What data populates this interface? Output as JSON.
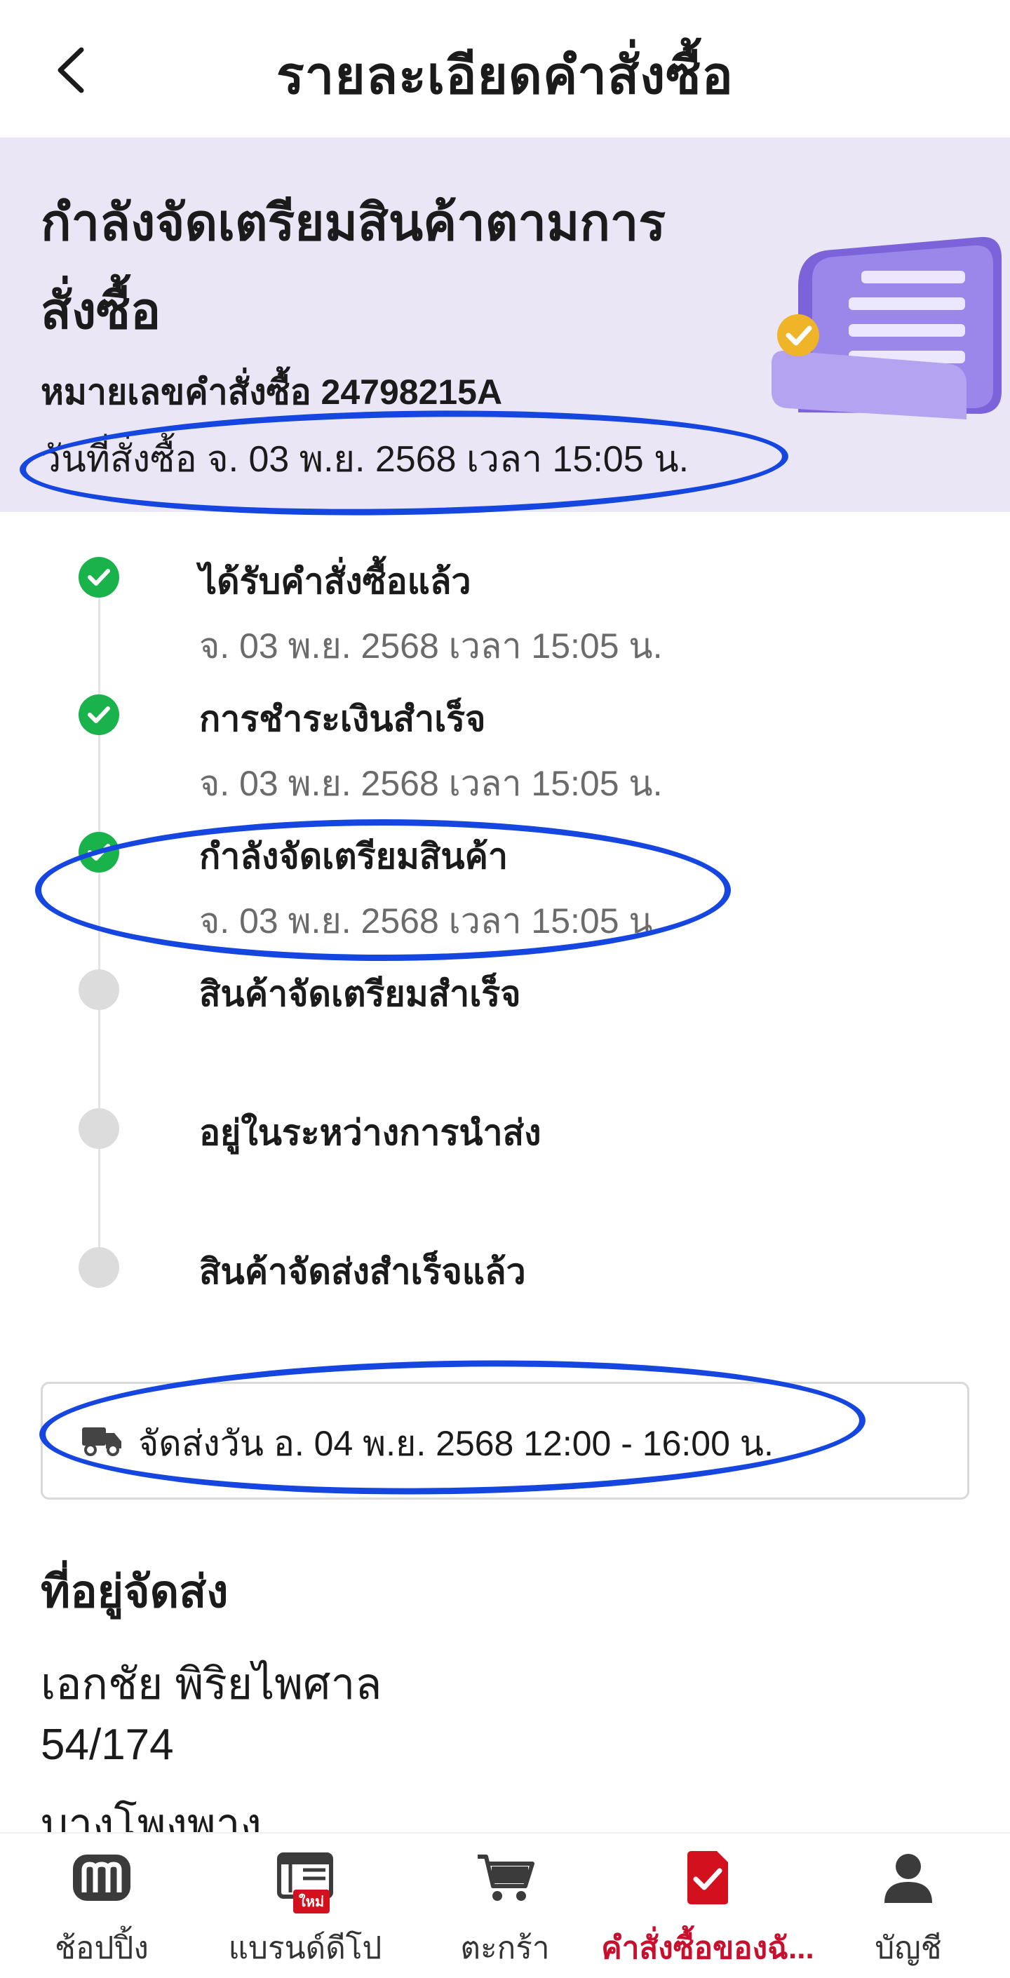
{
  "header": {
    "title": "รายละเอียดคำสั่งซื้อ",
    "back_icon": "chevron-left-icon"
  },
  "banner": {
    "status_title": "กำลังจัดเตรียมสินค้าตามการสั่งซื้อ",
    "order_number_label": "หมายเลขคำสั่งซื้อ",
    "order_number": "24798215A",
    "order_date_label": "วันที่สั่งซื้อ",
    "order_date": "จ. 03 พ.ย. 2568 เวลา 15:05 น.",
    "illustration": "receipt-illustration",
    "background_color": "#ebe6f6"
  },
  "timeline": {
    "steps": [
      {
        "label": "ได้รับคำสั่งซื้อแล้ว",
        "time": "จ. 03 พ.ย. 2568 เวลา 15:05 น.",
        "status": "done"
      },
      {
        "label": "การชำระเงินสำเร็จ",
        "time": "จ. 03 พ.ย. 2568 เวลา 15:05 น.",
        "status": "done"
      },
      {
        "label": "กำลังจัดเตรียมสินค้า",
        "time": "จ. 03 พ.ย. 2568 เวลา 15:05 น.",
        "status": "done"
      },
      {
        "label": "สินค้าจัดเตรียมสำเร็จ",
        "time": "",
        "status": "pending"
      },
      {
        "label": "อยู่ในระหว่างการนำส่ง",
        "time": "",
        "status": "pending"
      },
      {
        "label": "สินค้าจัดส่งสำเร็จแล้ว",
        "time": "",
        "status": "pending"
      }
    ],
    "done_color": "#19b24b",
    "pending_color": "#dcdcdc"
  },
  "delivery": {
    "icon": "truck-icon",
    "text": "จัดส่งวัน อ. 04 พ.ย. 2568 12:00 - 16:00 น."
  },
  "address": {
    "heading": "ที่อยู่จัดส่ง",
    "name": "เอกชัย พิริยไพศาล",
    "line1": "54/174",
    "line2": "บางโพงพาง"
  },
  "bottom_nav": {
    "items": [
      {
        "label": "ช้อปปิ้ง",
        "icon": "shop-m-icon",
        "active": false
      },
      {
        "label": "แบรนด์ดีโป",
        "icon": "store-new-icon",
        "badge": "ใหม่",
        "active": false
      },
      {
        "label": "ตะกร้า",
        "icon": "cart-icon",
        "active": false
      },
      {
        "label": "คำสั่งซื้อของฉั...",
        "icon": "order-check-icon",
        "active": true
      },
      {
        "label": "บัญชี",
        "icon": "account-icon",
        "active": false
      }
    ],
    "active_color": "#c8102e"
  },
  "annotation_color": "#1546e0"
}
